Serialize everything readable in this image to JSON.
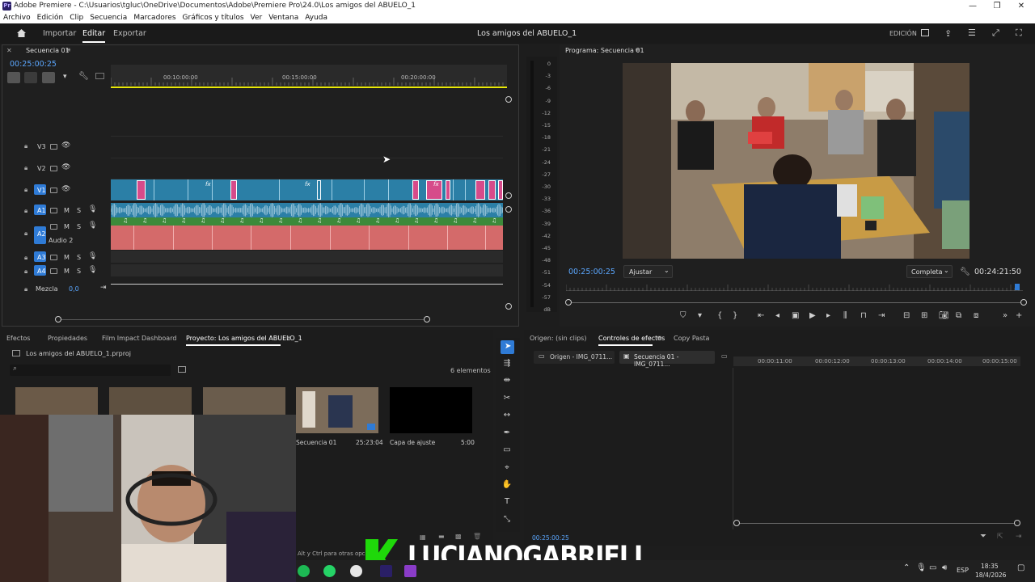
{
  "window": {
    "title": "Adobe Premiere - C:\\Usuarios\\tgluc\\OneDrive\\Documentos\\Adobe\\Premiere Pro\\24.0\\Los amigos del ABUELO_1",
    "logo_text": "Pr"
  },
  "menu": [
    "Archivo",
    "Edición",
    "Clip",
    "Secuencia",
    "Marcadores",
    "Gráficos y títulos",
    "Ver",
    "Ventana",
    "Ayuda"
  ],
  "header": {
    "tabs": [
      "Importar",
      "Editar",
      "Exportar"
    ],
    "active_tab": "Editar",
    "project_title": "Los amigos del ABUELO_1",
    "workspace": "EDICIÓN"
  },
  "timeline": {
    "sequence_tab": "Secuencia 01",
    "timecode": "00:25:00:25",
    "ruler": [
      "00:10:00:00",
      "00:15:00:00",
      "00:20:00:00"
    ],
    "tracks": {
      "v3": "V3",
      "v2": "V2",
      "v1": "V1",
      "a1": "A1",
      "a2": "A2",
      "a2_name": "Audio 2",
      "a3": "A3",
      "a4": "A4",
      "mix_label": "Mezcla",
      "mix_value": "0,0",
      "m": "M",
      "s": "S"
    },
    "fx_label": "fx",
    "note_glyph": "♫"
  },
  "program": {
    "title": "Programa: Secuencia 01",
    "timecode": "00:25:00:25",
    "fit": "Ajustar",
    "quality": "Completa",
    "duration": "00:24:21:50",
    "vu_scale": [
      "0",
      "-3",
      "-6",
      "-9",
      "-12",
      "-15",
      "-18",
      "-21",
      "-24",
      "-27",
      "-30",
      "-33",
      "-36",
      "-39",
      "-42",
      "-45",
      "-48",
      "-51",
      "-54",
      "-57",
      "dB"
    ]
  },
  "project_panel": {
    "tabs": [
      "Efectos",
      "Propiedades",
      "Film Impact Dashboard",
      "Proyecto: Los amigos del ABUELO_1"
    ],
    "active_tab": "Proyecto: Los amigos del ABUELO_1",
    "file": "Los amigos del ABUELO_1.prproj",
    "count": "6 elementos",
    "items": [
      {
        "name": "Secuencia 01",
        "duration": "25:23:04"
      },
      {
        "name": "Capa de ajuste",
        "duration": "5:00"
      }
    ],
    "hint": "Alt y Ctrl para otras opcion"
  },
  "effects_panel": {
    "tabs": [
      "Origen: (sin clips)",
      "Controles de efectos",
      "Copy Pasta"
    ],
    "active_tab": "Controles de efectos",
    "sources": [
      "Origen - IMG_0711...",
      "Secuencia 01 - IMG_0711..."
    ],
    "ruler": [
      "00:00:11:00",
      "00:00:12:00",
      "00:00:13:00",
      "00:00:14:00",
      "00:00:15:00"
    ],
    "timecode": "00:25:00:25"
  },
  "overlay": {
    "name": "LUCIANOGABRIELI",
    "logo": "K"
  },
  "taskbar": {
    "lang": "ESP",
    "time": "18:35",
    "date": "18/4/2026"
  },
  "colors": {
    "accent_blue": "#2f7bd6",
    "video_clip": "#2b7fa6",
    "pink_clip": "#d64b8a",
    "audio_green": "#3c8a3a",
    "audio2_pink": "#d46a6a",
    "yellow_line": "#e8e80a"
  }
}
